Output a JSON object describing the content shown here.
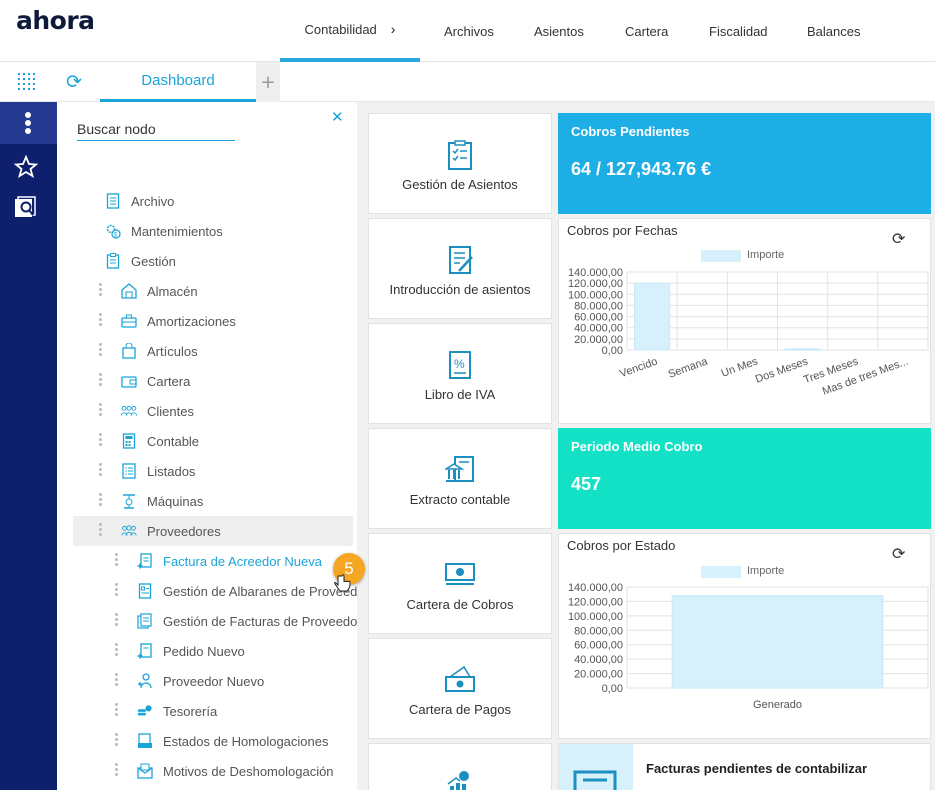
{
  "brand": {
    "logo": "ahora"
  },
  "topnav": {
    "items": [
      "Contabilidad",
      "Archivos",
      "Asientos",
      "Cartera",
      "Fiscalidad",
      "Balances"
    ],
    "active": "Contabilidad"
  },
  "tabs": {
    "dashboard_label": "Dashboard",
    "add_label": "+"
  },
  "tree": {
    "search_placeholder": "Buscar nodo",
    "close_label": "✕",
    "nodes": [
      {
        "label": "Archivo",
        "icon": "file-icon"
      },
      {
        "label": "Mantenimientos",
        "icon": "settings-money-icon"
      },
      {
        "label": "Gestión",
        "icon": "clipboard-icon"
      },
      {
        "label": "Almacén",
        "icon": "warehouse-icon"
      },
      {
        "label": "Amortizaciones",
        "icon": "briefcase-icon"
      },
      {
        "label": "Artículos",
        "icon": "shopping-bag-icon"
      },
      {
        "label": "Cartera",
        "icon": "wallet-icon"
      },
      {
        "label": "Clientes",
        "icon": "people-icon"
      },
      {
        "label": "Contable",
        "icon": "calculator-icon"
      },
      {
        "label": "Listados",
        "icon": "list-icon"
      },
      {
        "label": "Máquinas",
        "icon": "machine-icon"
      },
      {
        "label": "Proveedores",
        "icon": "group-icon"
      },
      {
        "label": "Factura de Acreedor Nueva",
        "icon": "invoice-add-icon"
      },
      {
        "label": "Gestión de Albaranes de Proveedo",
        "icon": "delivery-note-icon"
      },
      {
        "label": "Gestión de Facturas de Proveedo",
        "icon": "invoices-icon"
      },
      {
        "label": "Pedido Nuevo",
        "icon": "order-add-icon"
      },
      {
        "label": "Proveedor Nuevo",
        "icon": "user-add-icon"
      },
      {
        "label": "Tesorería",
        "icon": "coins-icon"
      },
      {
        "label": "Estados de Homologaciones",
        "icon": "inbox-icon"
      },
      {
        "label": "Motivos de Deshomologación",
        "icon": "mail-icon"
      }
    ],
    "step_badge": "5"
  },
  "tiles": [
    {
      "label": "Gestión de Asientos",
      "icon": "checklist-icon"
    },
    {
      "label": "Introducción de asientos",
      "icon": "document-pen-icon"
    },
    {
      "label": "Libro de IVA",
      "icon": "percent-doc-icon"
    },
    {
      "label": "Extracto contable",
      "icon": "bank-doc-icon"
    },
    {
      "label": "Cartera de Cobros",
      "icon": "cash-icon"
    },
    {
      "label": "Cartera de Pagos",
      "icon": "payments-icon"
    }
  ],
  "kpis": {
    "cobros_pendientes": {
      "title": "Cobros Pendientes",
      "value": "64 / 127,943.76 €",
      "color": "#1eaee6"
    },
    "periodo_medio": {
      "title": "Periodo Medio Cobro",
      "value": "457",
      "color": "#12e1c6"
    }
  },
  "facturas_card": {
    "title": "Facturas pendientes de contabilizar"
  },
  "chart_data": [
    {
      "type": "bar",
      "title": "Cobros por Fechas",
      "series": [
        {
          "name": "Importe",
          "values": [
            120000,
            0,
            0,
            2000,
            0,
            0
          ]
        }
      ],
      "categories": [
        "Vencido",
        "Semana",
        "Un Mes",
        "Dos Meses",
        "Tres Meses",
        "Mas de tres Mes..."
      ],
      "yticks": [
        "140.000,00",
        "120.000,00",
        "100.000,00",
        "80.000,00",
        "60.000,00",
        "40.000,00",
        "20.000,00",
        "0,00"
      ],
      "ylim": [
        0,
        140000
      ],
      "color": "#d6f1fb",
      "grid": true,
      "legend": "top"
    },
    {
      "type": "bar",
      "title": "Cobros por Estado",
      "series": [
        {
          "name": "Importe",
          "values": [
            127943.76
          ]
        }
      ],
      "categories": [
        "Generado"
      ],
      "yticks": [
        "140.000,00",
        "120.000,00",
        "100.000,00",
        "80.000,00",
        "60.000,00",
        "40.000,00",
        "20.000,00",
        "0,00"
      ],
      "ylim": [
        0,
        140000
      ],
      "color": "#d6f1fb",
      "grid": true,
      "legend": "top"
    }
  ]
}
